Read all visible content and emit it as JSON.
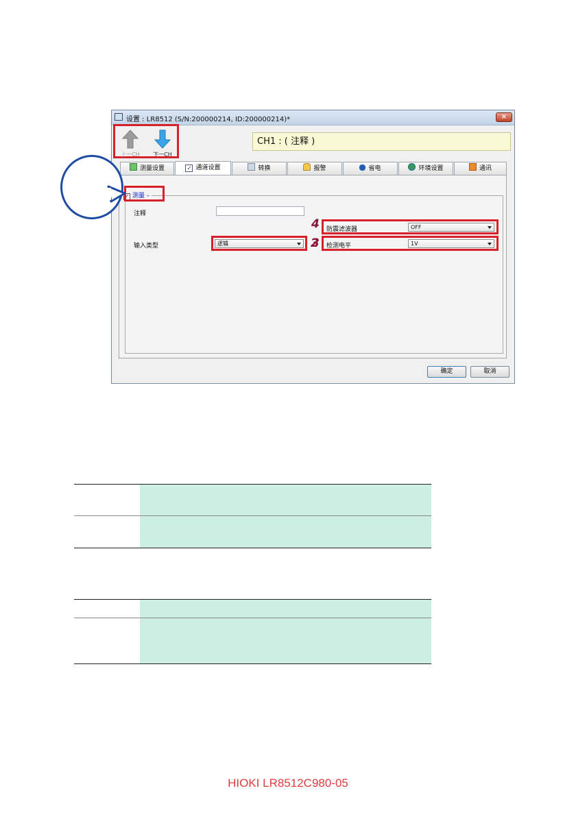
{
  "window": {
    "title": "设置 : LR8512 (S/N:200000214, ID:200000214)*",
    "close_label": "×"
  },
  "nav": {
    "prev_label": "上一CH",
    "next_label": "下一CH"
  },
  "channel_label": "CH1 : ( 注释 )",
  "tabs": [
    {
      "label": "测量设置"
    },
    {
      "label": "通道设置"
    },
    {
      "label": "转换"
    },
    {
      "label": "报警"
    },
    {
      "label": "省电"
    },
    {
      "label": "环境设置"
    },
    {
      "label": "通讯"
    }
  ],
  "group": {
    "check_mark": "✓",
    "title": "测量"
  },
  "fields": {
    "comment_label": "注释",
    "comment_value": "",
    "input_type_label": "输入类型",
    "input_type_value": "逻辑",
    "filter_label": "防震滤波器",
    "filter_value": "OFF",
    "level_label": "检测电平",
    "level_value": "1V"
  },
  "markers": {
    "m2": "2",
    "m3": "3",
    "m4": "4"
  },
  "buttons": {
    "ok": "确定",
    "cancel": "取消"
  },
  "footer": "HIOKI LR8512C980-05"
}
